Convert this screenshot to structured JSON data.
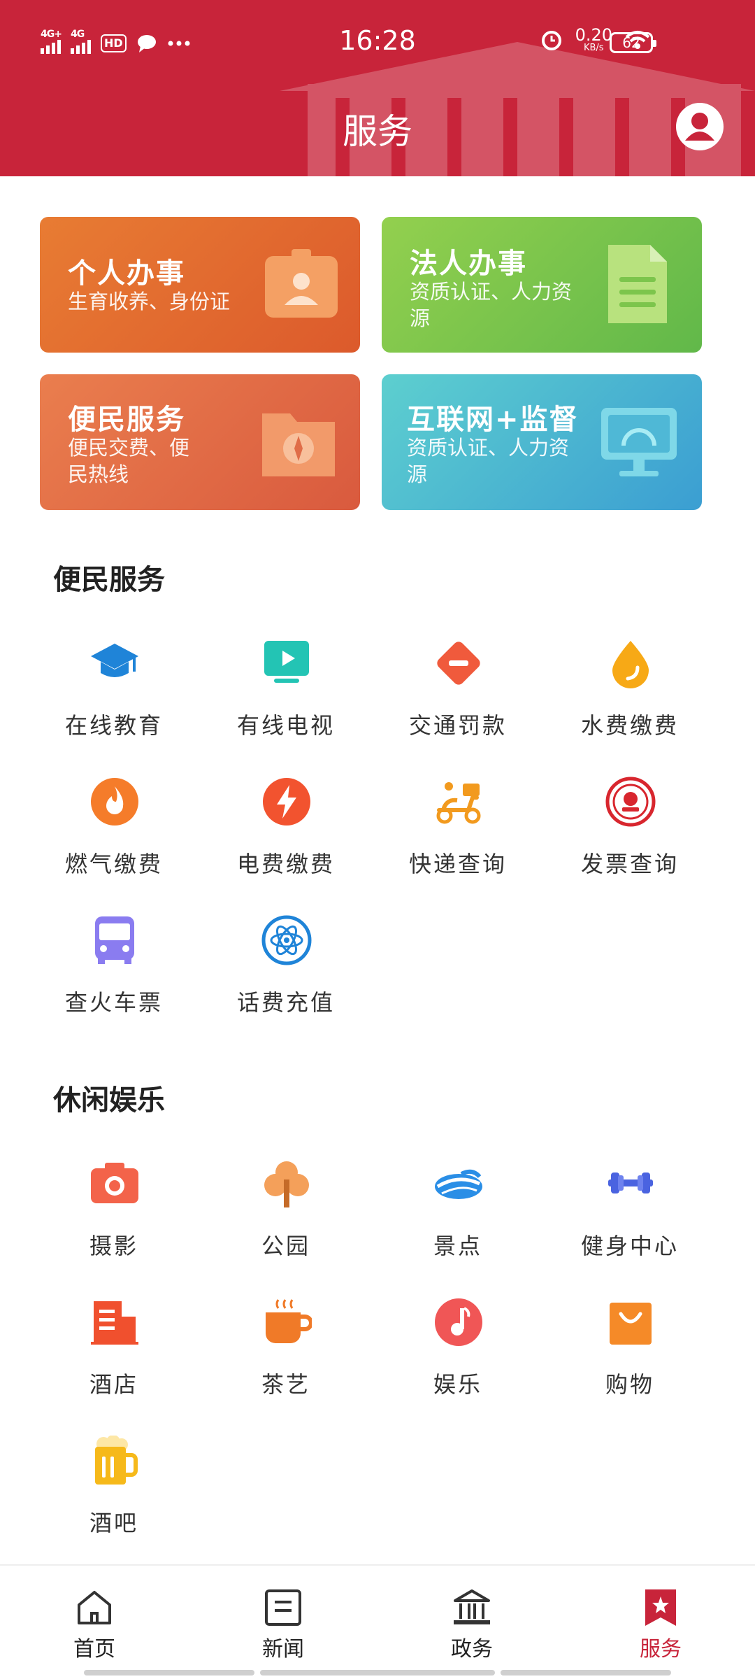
{
  "status_bar": {
    "network_1": "4G+",
    "network_2": "4G",
    "hd": "HD",
    "time": "16:28",
    "speed_value": "0.20",
    "speed_unit": "KB/s",
    "battery": "62"
  },
  "header": {
    "title": "服务"
  },
  "cards": [
    {
      "title": "个人办事",
      "subtitle": "生育收养、身份证",
      "color": "#e26d30"
    },
    {
      "title": "法人办事",
      "subtitle": "资质认证、人力资源",
      "color": "#7cc54c"
    },
    {
      "title": "便民服务",
      "subtitle": "便民交费、便民热线",
      "color": "#e06d48"
    },
    {
      "title": "互联网+监督",
      "subtitle": "资质认证、人力资源",
      "color": "#4bb6d0"
    }
  ],
  "section_convenience": {
    "title": "便民服务",
    "items": [
      {
        "label": "在线教育",
        "icon": "graduation-cap-icon"
      },
      {
        "label": "有线电视",
        "icon": "tv-icon"
      },
      {
        "label": "交通罚款",
        "icon": "no-entry-icon"
      },
      {
        "label": "水费缴费",
        "icon": "water-drop-icon"
      },
      {
        "label": "燃气缴费",
        "icon": "flame-icon"
      },
      {
        "label": "电费缴费",
        "icon": "lightning-icon"
      },
      {
        "label": "快递查询",
        "icon": "delivery-scooter-icon"
      },
      {
        "label": "发票查询",
        "icon": "emblem-icon"
      },
      {
        "label": "查火车票",
        "icon": "bus-icon"
      },
      {
        "label": "话费充值",
        "icon": "atom-icon"
      }
    ]
  },
  "section_leisure": {
    "title": "休闲娱乐",
    "items": [
      {
        "label": "摄影",
        "icon": "camera-icon"
      },
      {
        "label": "公园",
        "icon": "tree-icon"
      },
      {
        "label": "景点",
        "icon": "landscape-icon"
      },
      {
        "label": "健身中心",
        "icon": "dumbbell-icon"
      },
      {
        "label": "酒店",
        "icon": "hotel-icon"
      },
      {
        "label": "茶艺",
        "icon": "teacup-icon"
      },
      {
        "label": "娱乐",
        "icon": "music-note-icon"
      },
      {
        "label": "购物",
        "icon": "shopping-bag-icon"
      },
      {
        "label": "酒吧",
        "icon": "beer-icon"
      }
    ]
  },
  "bottom_nav": {
    "items": [
      {
        "label": "首页",
        "icon": "home-icon"
      },
      {
        "label": "新闻",
        "icon": "news-icon"
      },
      {
        "label": "政务",
        "icon": "government-icon"
      },
      {
        "label": "服务",
        "icon": "bookmark-star-icon",
        "active": true
      }
    ]
  },
  "colors": {
    "brand_red": "#c8243a",
    "text": "#333333"
  }
}
